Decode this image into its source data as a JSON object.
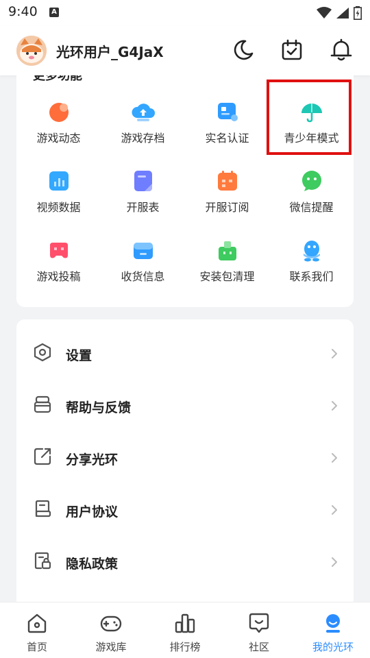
{
  "status_bar": {
    "time": "9:40",
    "notification_badge": "A"
  },
  "header": {
    "username": "光环用户_G4JaX",
    "icons": [
      "moon-icon",
      "calendar-check-icon",
      "bell-icon"
    ]
  },
  "functions": {
    "title": "更多功能",
    "items": [
      {
        "label": "游戏动态",
        "icon": "game-news-icon",
        "color": "#ff6d3b"
      },
      {
        "label": "游戏存档",
        "icon": "cloud-save-icon",
        "color": "#33a6ff"
      },
      {
        "label": "实名认证",
        "icon": "id-card-icon",
        "color": "#2f9bff"
      },
      {
        "label": "青少年模式",
        "icon": "umbrella-icon",
        "color": "#1cc7b3"
      },
      {
        "label": "视频数据",
        "icon": "video-data-icon",
        "color": "#32a8ff"
      },
      {
        "label": "开服表",
        "icon": "server-list-icon",
        "color": "#6f7dff"
      },
      {
        "label": "开服订阅",
        "icon": "calendar-subscribe-icon",
        "color": "#ff7a3d"
      },
      {
        "label": "微信提醒",
        "icon": "wechat-icon",
        "color": "#3ecb5f"
      },
      {
        "label": "游戏投稿",
        "icon": "gamepad-submit-icon",
        "color": "#ff4f6b"
      },
      {
        "label": "收货信息",
        "icon": "delivery-box-icon",
        "color": "#2f9bff"
      },
      {
        "label": "安装包清理",
        "icon": "cleanup-icon",
        "color": "#3ecb5f"
      },
      {
        "label": "联系我们",
        "icon": "qq-contact-icon",
        "color": "#33a6ff"
      }
    ]
  },
  "settings": {
    "items": [
      {
        "label": "设置",
        "icon": "settings-hex-icon"
      },
      {
        "label": "帮助与反馈",
        "icon": "help-feedback-icon"
      },
      {
        "label": "分享光环",
        "icon": "share-icon"
      },
      {
        "label": "用户协议",
        "icon": "user-agreement-icon"
      },
      {
        "label": "隐私政策",
        "icon": "privacy-lock-icon"
      }
    ]
  },
  "bottom_nav": {
    "items": [
      {
        "label": "首页",
        "icon": "home-icon",
        "active": false
      },
      {
        "label": "游戏库",
        "icon": "gamepad-icon",
        "active": false
      },
      {
        "label": "排行榜",
        "icon": "ranking-icon",
        "active": false
      },
      {
        "label": "社区",
        "icon": "community-icon",
        "active": false
      },
      {
        "label": "我的光环",
        "icon": "profile-icon",
        "active": true
      }
    ]
  },
  "colors": {
    "accent": "#2b8cff",
    "highlight": "#e01010"
  }
}
